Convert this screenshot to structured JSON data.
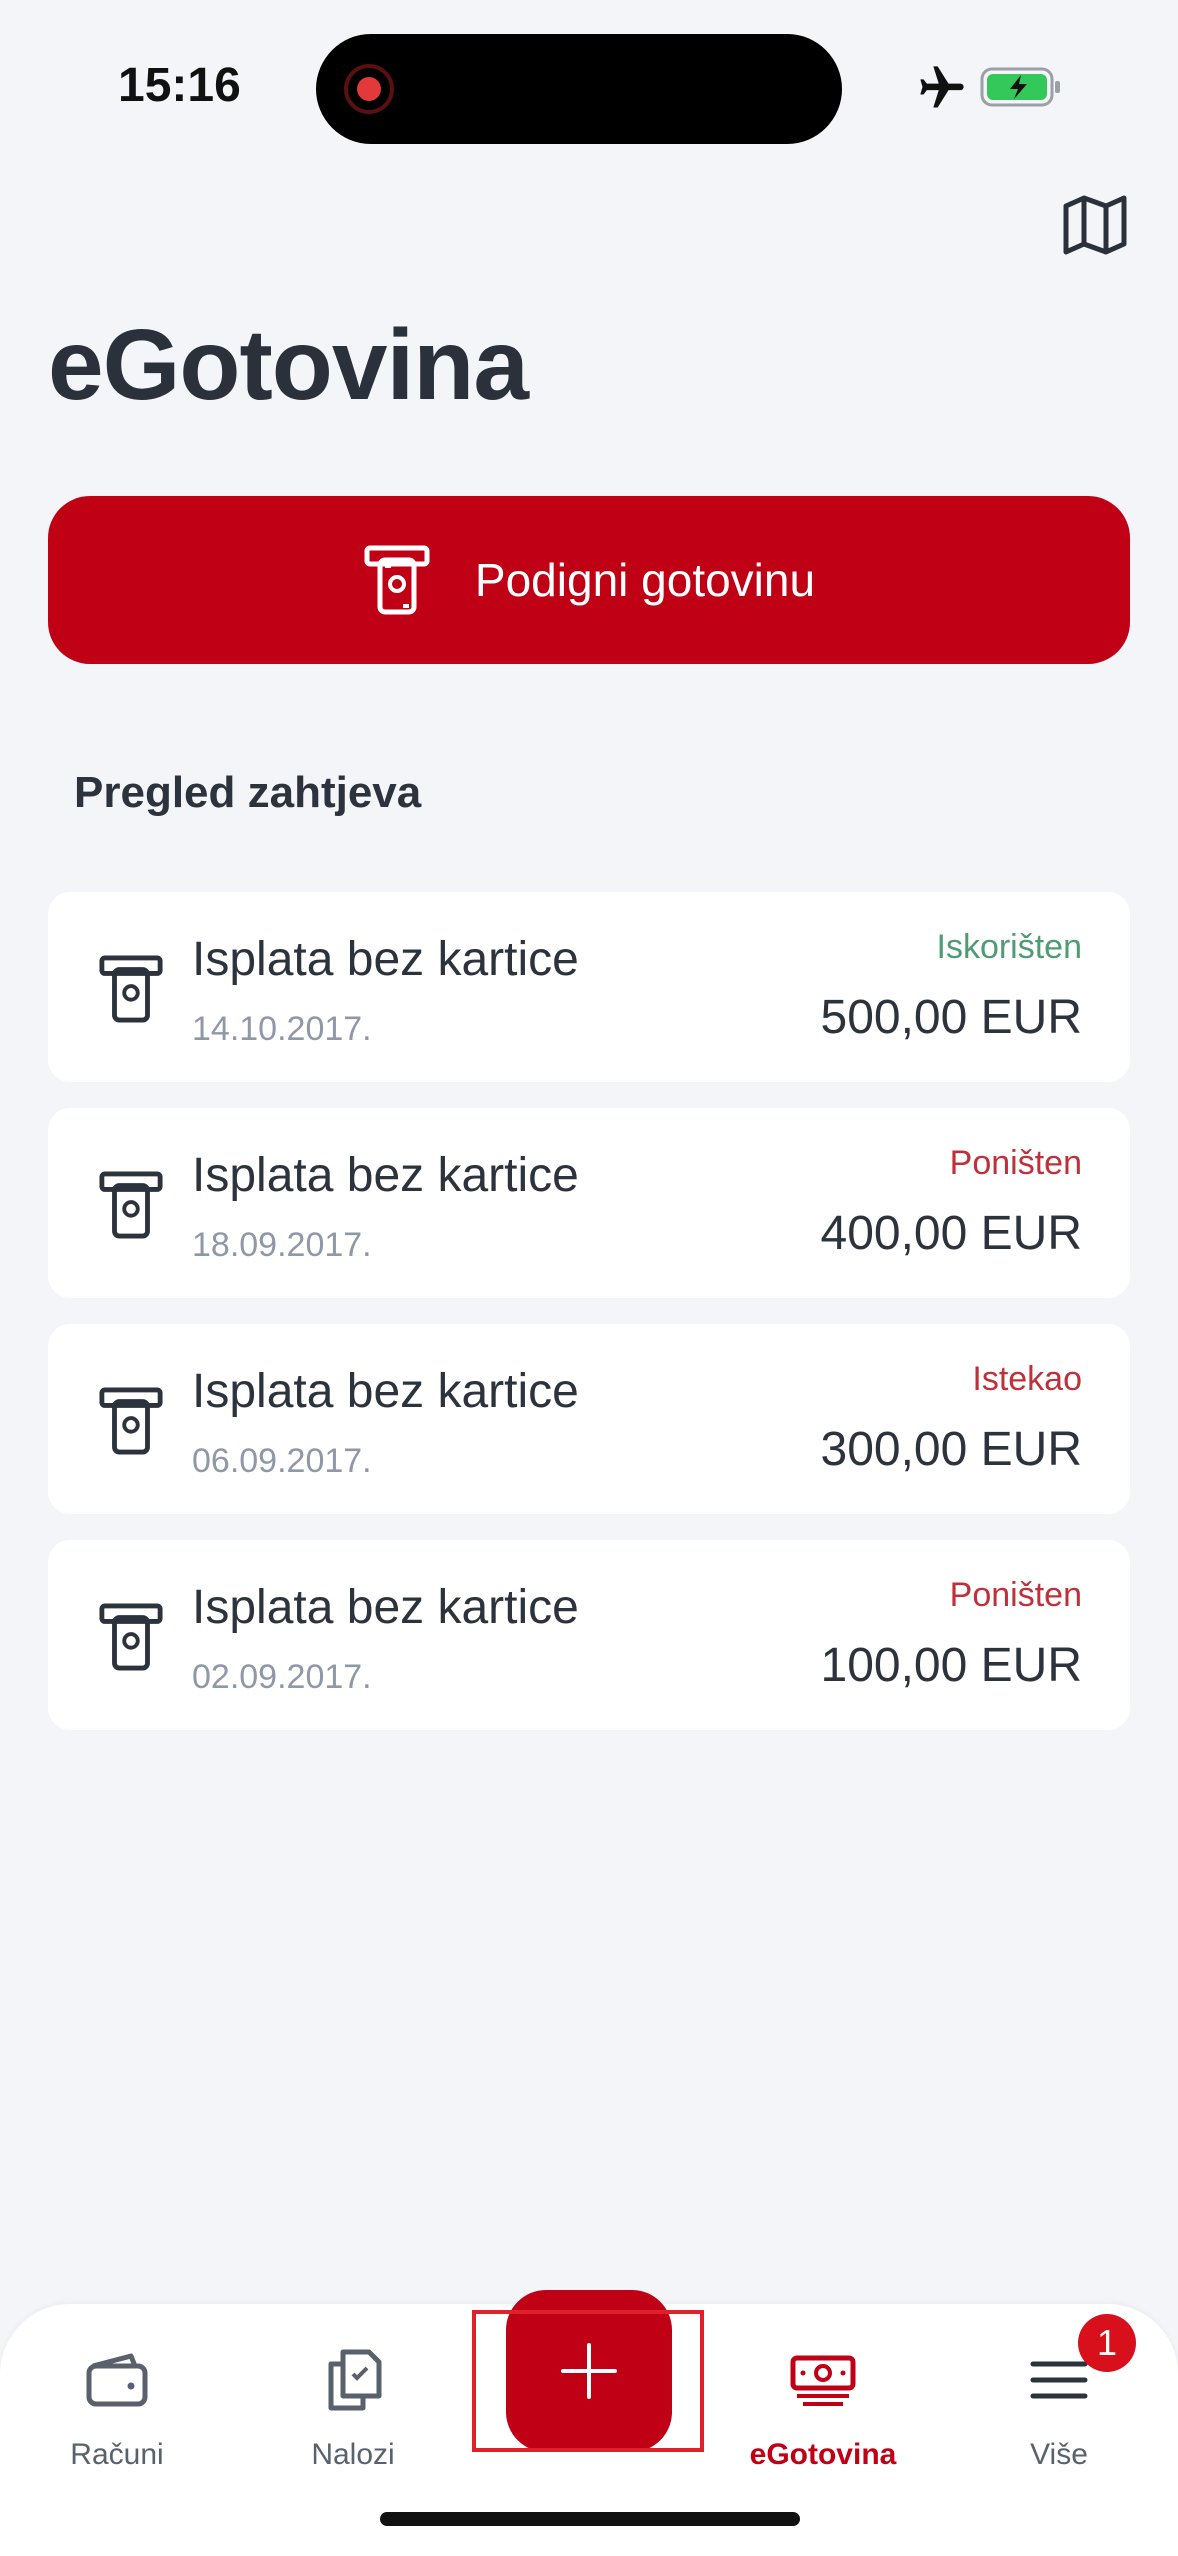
{
  "status_bar": {
    "time": "15:16"
  },
  "header": {
    "title": "eGotovina"
  },
  "withdraw_button": {
    "label": "Podigni gotovinu"
  },
  "section": {
    "title": "Pregled zahtjeva"
  },
  "requests": [
    {
      "title": "Isplata bez kartice",
      "date": "14.10.2017.",
      "status": "Iskorišten",
      "amount": "500,00 EUR"
    },
    {
      "title": "Isplata bez kartice",
      "date": "18.09.2017.",
      "status": "Poništen",
      "amount": "400,00 EUR"
    },
    {
      "title": "Isplata bez kartice",
      "date": "06.09.2017.",
      "status": "Istekao",
      "amount": "300,00 EUR"
    },
    {
      "title": "Isplata bez kartice",
      "date": "02.09.2017.",
      "status": "Poništen",
      "amount": "100,00 EUR"
    }
  ],
  "tabbar": {
    "items": [
      {
        "label": "Računi",
        "icon": "wallet-icon"
      },
      {
        "label": "Nalozi",
        "icon": "documents-icon"
      },
      {
        "label": "eGotovina",
        "icon": "cash-icon",
        "active": true
      },
      {
        "label": "Više",
        "icon": "menu-icon",
        "badge": "1"
      }
    ],
    "fab_icon": "plus-icon"
  },
  "colors": {
    "brand_red": "#bf0015",
    "status_green": "#4d9c74",
    "status_red": "#c0303a",
    "background": "#f4f5f9"
  }
}
